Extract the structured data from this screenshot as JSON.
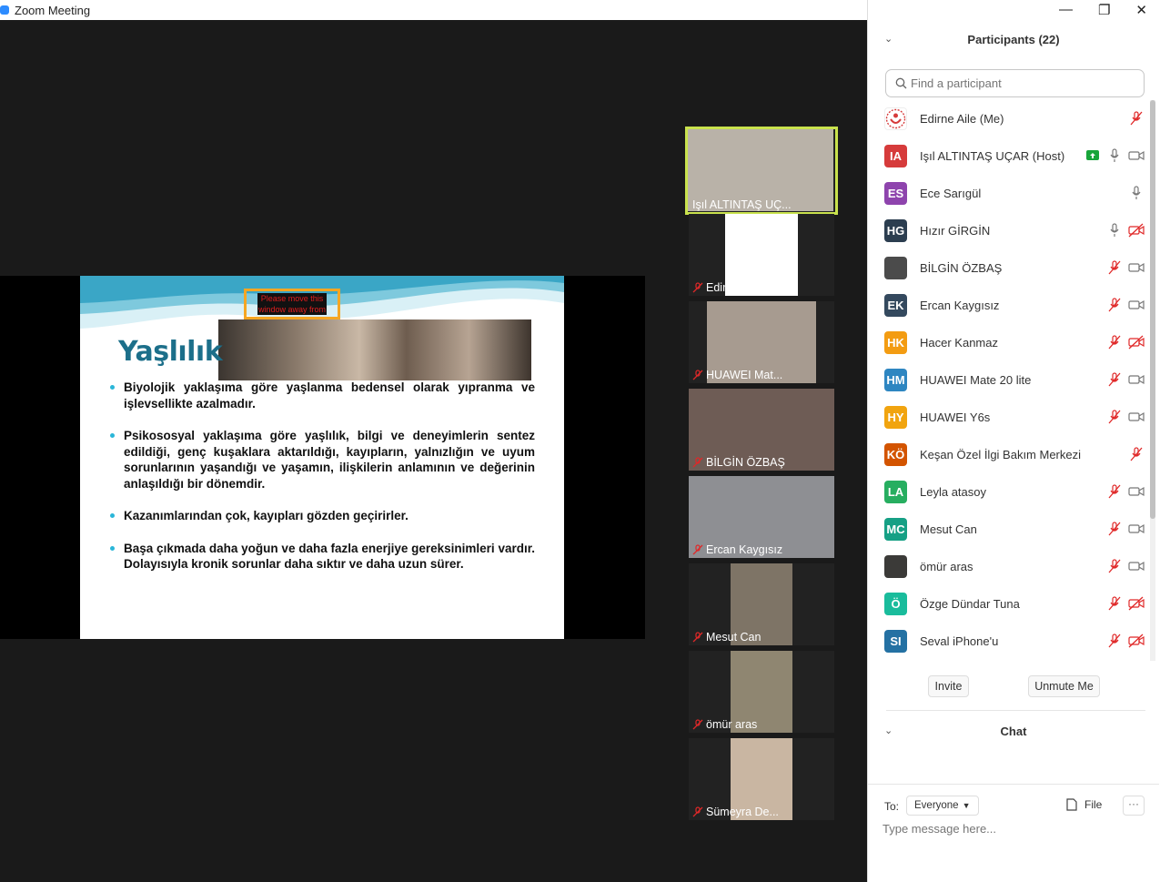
{
  "window": {
    "title": "Zoom Meeting"
  },
  "slide": {
    "title": "Yaşlılık",
    "notice": "Please move this window away from",
    "bullets": [
      "Biyolojik yaklaşıma göre yaşlanma bedensel olarak yıpranma ve işlevsellikte azalmadır.",
      "Psikososyal yaklaşıma göre yaşlılık, bilgi ve deneyimlerin sentez edildiği, genç kuşaklara aktarıldığı, kayıpların, yalnızlığın ve uyum sorunlarının yaşandığı ve yaşamın, ilişkilerin anlamının ve değerinin anlaşıldığı bir dönemdir.",
      "Kazanımlarından çok, kayıpları gözden geçirirler.",
      "Başa çıkmada daha yoğun ve daha fazla enerjiye gereksinimleri vardır. Dolayısıyla kronik sorunlar daha sıktır ve daha uzun sürer."
    ]
  },
  "gallery": [
    {
      "name": "Işıl ALTINTAŞ UÇ...",
      "muted": false,
      "active": true,
      "tone": "#b9b2a8"
    },
    {
      "name": "Edirne Aile",
      "muted": true,
      "active": false,
      "tone": "#ffffff"
    },
    {
      "name": "HUAWEI Mat...",
      "muted": true,
      "active": false,
      "tone": "#a79b90"
    },
    {
      "name": "BİLGİN ÖZBAŞ",
      "muted": true,
      "active": false,
      "tone": "#6e5c55"
    },
    {
      "name": "Ercan Kaygısız",
      "muted": true,
      "active": false,
      "tone": "#8e8f93"
    },
    {
      "name": "Mesut Can",
      "muted": true,
      "active": false,
      "tone": "#7e7466"
    },
    {
      "name": "ömür aras",
      "muted": true,
      "active": false,
      "tone": "#8f8671"
    },
    {
      "name": "Sümeyra De...",
      "muted": true,
      "active": false,
      "tone": "#c9b6a2"
    }
  ],
  "participants_panel": {
    "title": "Participants (22)",
    "search_placeholder": "Find a participant",
    "participants": [
      {
        "initials": "",
        "name": "Edirne Aile (Me)",
        "color": "#ffffff",
        "status": [
          "mic-muted"
        ]
      },
      {
        "initials": "IA",
        "name": "Işıl ALTINTAŞ UÇAR (Host)",
        "color": "#d63b3b",
        "status": [
          "share",
          "mic",
          "video"
        ]
      },
      {
        "initials": "ES",
        "name": "Ece Sarıgül",
        "color": "#8e44ad",
        "status": [
          "mic"
        ]
      },
      {
        "initials": "HG",
        "name": "Hızır GİRGİN",
        "color": "#2c3e50",
        "status": [
          "mic",
          "video-off"
        ]
      },
      {
        "initials": "",
        "name": "BİLGİN ÖZBAŞ",
        "color": "#4b4b4b",
        "status": [
          "mic-muted",
          "video"
        ]
      },
      {
        "initials": "EK",
        "name": "Ercan Kaygısız",
        "color": "#34495e",
        "status": [
          "mic-muted",
          "video"
        ]
      },
      {
        "initials": "HK",
        "name": "Hacer Kanmaz",
        "color": "#f39c12",
        "status": [
          "mic-muted",
          "video-off"
        ]
      },
      {
        "initials": "HM",
        "name": "HUAWEI Mate 20 lite",
        "color": "#2e86c1",
        "status": [
          "mic-muted",
          "video"
        ]
      },
      {
        "initials": "HY",
        "name": "HUAWEI Y6s",
        "color": "#f1a40f",
        "status": [
          "mic-muted",
          "video"
        ]
      },
      {
        "initials": "KÖ",
        "name": "Keşan Özel İlgi Bakım Merkezi",
        "color": "#d35400",
        "status": [
          "mic-muted"
        ]
      },
      {
        "initials": "LA",
        "name": "Leyla atasoy",
        "color": "#27ae60",
        "status": [
          "mic-muted",
          "video"
        ]
      },
      {
        "initials": "MC",
        "name": "Mesut Can",
        "color": "#16a085",
        "status": [
          "mic-muted",
          "video"
        ]
      },
      {
        "initials": "",
        "name": "ömür aras",
        "color": "#3b3a38",
        "status": [
          "mic-muted",
          "video"
        ]
      },
      {
        "initials": "Ö",
        "name": "Özge Dündar Tuna",
        "color": "#1abc9c",
        "status": [
          "mic-muted",
          "video-off"
        ]
      },
      {
        "initials": "SI",
        "name": "Seval iPhone'u",
        "color": "#2471a3",
        "status": [
          "mic-muted",
          "video-off"
        ]
      }
    ],
    "invite_label": "Invite",
    "unmute_label": "Unmute Me"
  },
  "chat": {
    "title": "Chat",
    "to_label": "To:",
    "recipient": "Everyone",
    "file_label": "File",
    "more_label": "···",
    "placeholder": "Type message here..."
  }
}
